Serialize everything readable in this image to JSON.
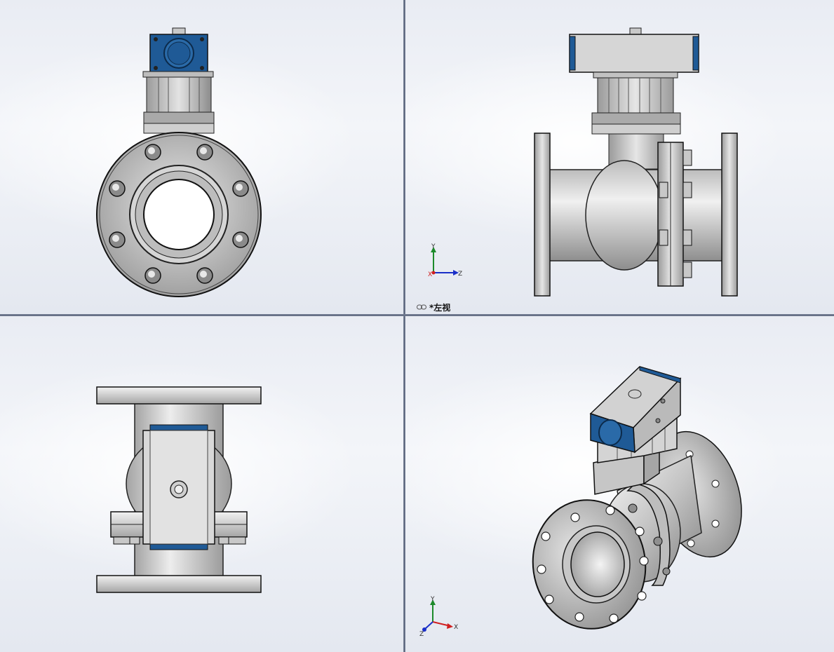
{
  "window": {
    "layout": "four-view"
  },
  "viewports": {
    "top_left": {
      "name": "front-view"
    },
    "top_right": {
      "name": "left-view",
      "label": "*左视"
    },
    "bottom_left": {
      "name": "top-view"
    },
    "bottom_right": {
      "name": "isometric-view"
    }
  },
  "triad": {
    "left": {
      "axes": [
        "Y",
        "X",
        "Z"
      ]
    },
    "iso": {
      "axes": [
        "Y",
        "X",
        "Z"
      ]
    }
  },
  "colors": {
    "actuator_blue": "#1f5a96",
    "metal_light": "#d9d9d9",
    "metal_dark": "#9a9a9a",
    "outline": "#222222",
    "axis_x": "#d02020",
    "axis_y": "#1c8a2a",
    "axis_z": "#1a2fc8"
  },
  "icons": [
    "link-chain-icon",
    "coordinate-triad-icon"
  ]
}
